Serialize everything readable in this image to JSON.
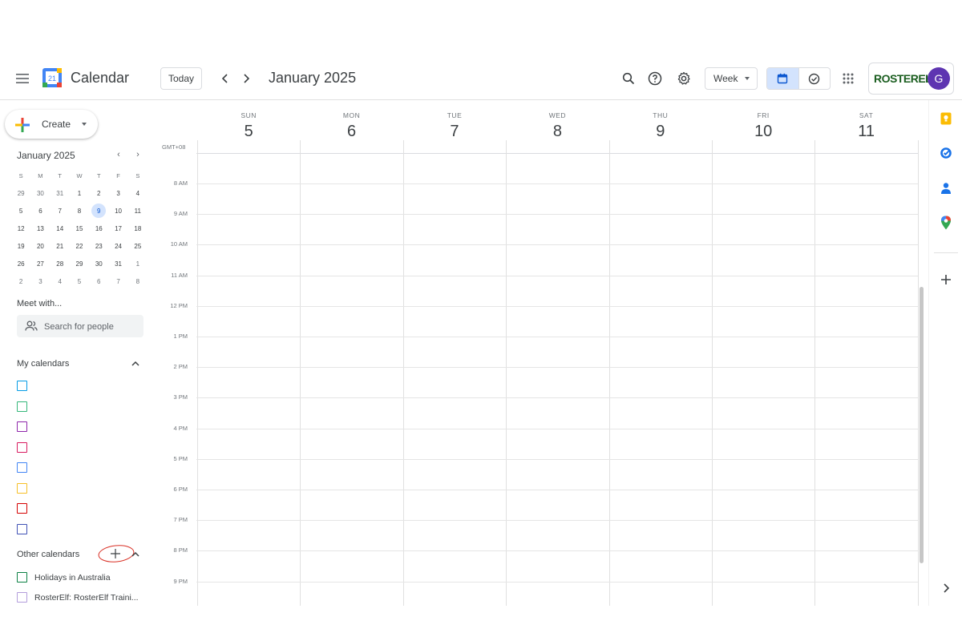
{
  "header": {
    "app_title": "Calendar",
    "logo_date": "21",
    "today_label": "Today",
    "month_title": "January 2025",
    "view_select": "Week",
    "brand": "ROSTERELF",
    "avatar_initial": "G"
  },
  "sidebar": {
    "create_label": "Create",
    "mini_calendar": {
      "title": "January 2025",
      "weekday_heads": [
        "S",
        "M",
        "T",
        "W",
        "T",
        "F",
        "S"
      ],
      "weeks": [
        [
          "29",
          "30",
          "31",
          "1",
          "2",
          "3",
          "4"
        ],
        [
          "5",
          "6",
          "7",
          "8",
          "9",
          "10",
          "11"
        ],
        [
          "12",
          "13",
          "14",
          "15",
          "16",
          "17",
          "18"
        ],
        [
          "19",
          "20",
          "21",
          "22",
          "23",
          "24",
          "25"
        ],
        [
          "26",
          "27",
          "28",
          "29",
          "30",
          "31",
          "1"
        ],
        [
          "2",
          "3",
          "4",
          "5",
          "6",
          "7",
          "8"
        ]
      ],
      "today": "9"
    },
    "meet_with_label": "Meet with...",
    "search_people_placeholder": "Search for people",
    "my_calendars_label": "My calendars",
    "my_calendar_colors": [
      "#039be5",
      "#33b679",
      "#8e24aa",
      "#d81b60",
      "#4285f4",
      "#f6bf26",
      "#d50000",
      "#3f51b5"
    ],
    "other_calendars_label": "Other calendars",
    "other_calendars": [
      {
        "label": "Holidays in Australia",
        "color": "#0b8043"
      },
      {
        "label": "RosterElf: RosterElf Traini...",
        "color": "#b39ddb"
      }
    ]
  },
  "week": {
    "timezone": "GMT+08",
    "days": [
      {
        "name": "SUN",
        "num": "5"
      },
      {
        "name": "MON",
        "num": "6"
      },
      {
        "name": "TUE",
        "num": "7"
      },
      {
        "name": "WED",
        "num": "8"
      },
      {
        "name": "THU",
        "num": "9"
      },
      {
        "name": "FRI",
        "num": "10"
      },
      {
        "name": "SAT",
        "num": "11"
      }
    ],
    "hours": [
      "8 AM",
      "9 AM",
      "10 AM",
      "11 AM",
      "12 PM",
      "1 PM",
      "2 PM",
      "3 PM",
      "4 PM",
      "5 PM",
      "6 PM",
      "7 PM",
      "8 PM",
      "9 PM"
    ]
  },
  "colors": {
    "accent": "#0b57d0",
    "today_bg": "#d3e3fd",
    "annotation": "#d93025"
  }
}
